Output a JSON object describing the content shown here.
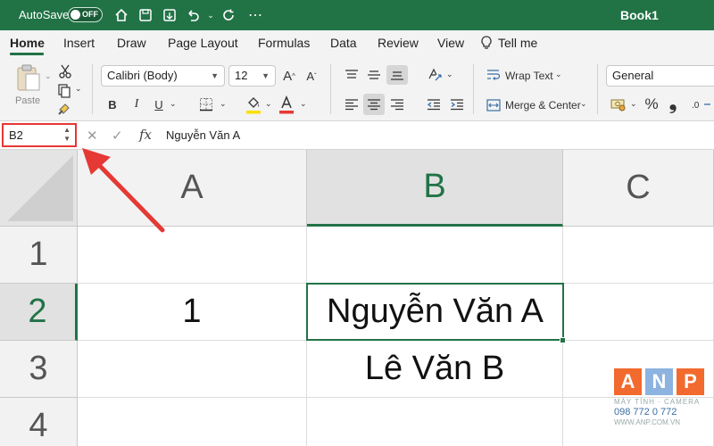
{
  "titlebar": {
    "autosave_label": "AutoSave",
    "autosave_state": "OFF",
    "book_title": "Book1"
  },
  "tabs": [
    {
      "label": "Home",
      "active": true
    },
    {
      "label": "Insert"
    },
    {
      "label": "Draw"
    },
    {
      "label": "Page Layout"
    },
    {
      "label": "Formulas"
    },
    {
      "label": "Data"
    },
    {
      "label": "Review"
    },
    {
      "label": "View"
    },
    {
      "label": "Tell me"
    }
  ],
  "ribbon": {
    "paste_label": "Paste",
    "font_name": "Calibri (Body)",
    "font_size": "12",
    "bold": "B",
    "italic": "I",
    "underline": "U",
    "wrap_text": "Wrap Text",
    "merge_center": "Merge & Center",
    "number_format": "General",
    "percent": "%",
    "comma": "❟"
  },
  "formula_bar": {
    "name_box": "B2",
    "fx_label": "fx",
    "content": "Nguyễn Văn A"
  },
  "grid": {
    "columns": [
      "A",
      "B",
      "C"
    ],
    "rows": [
      "1",
      "2",
      "3",
      "4"
    ],
    "cells": {
      "A2": "1",
      "B2": "Nguyễn Văn A",
      "B3": "Lê Văn B"
    },
    "selected_cell": "B2"
  },
  "watermark": {
    "letters": [
      "A",
      "N",
      "P"
    ],
    "subtitle": "MÁY TÍNH · CAMERA",
    "phone": "098 772 0 772",
    "site": "WWW.ANP.COM.VN"
  },
  "colors": {
    "excel_green": "#217346",
    "annotation_red": "#e53935"
  }
}
